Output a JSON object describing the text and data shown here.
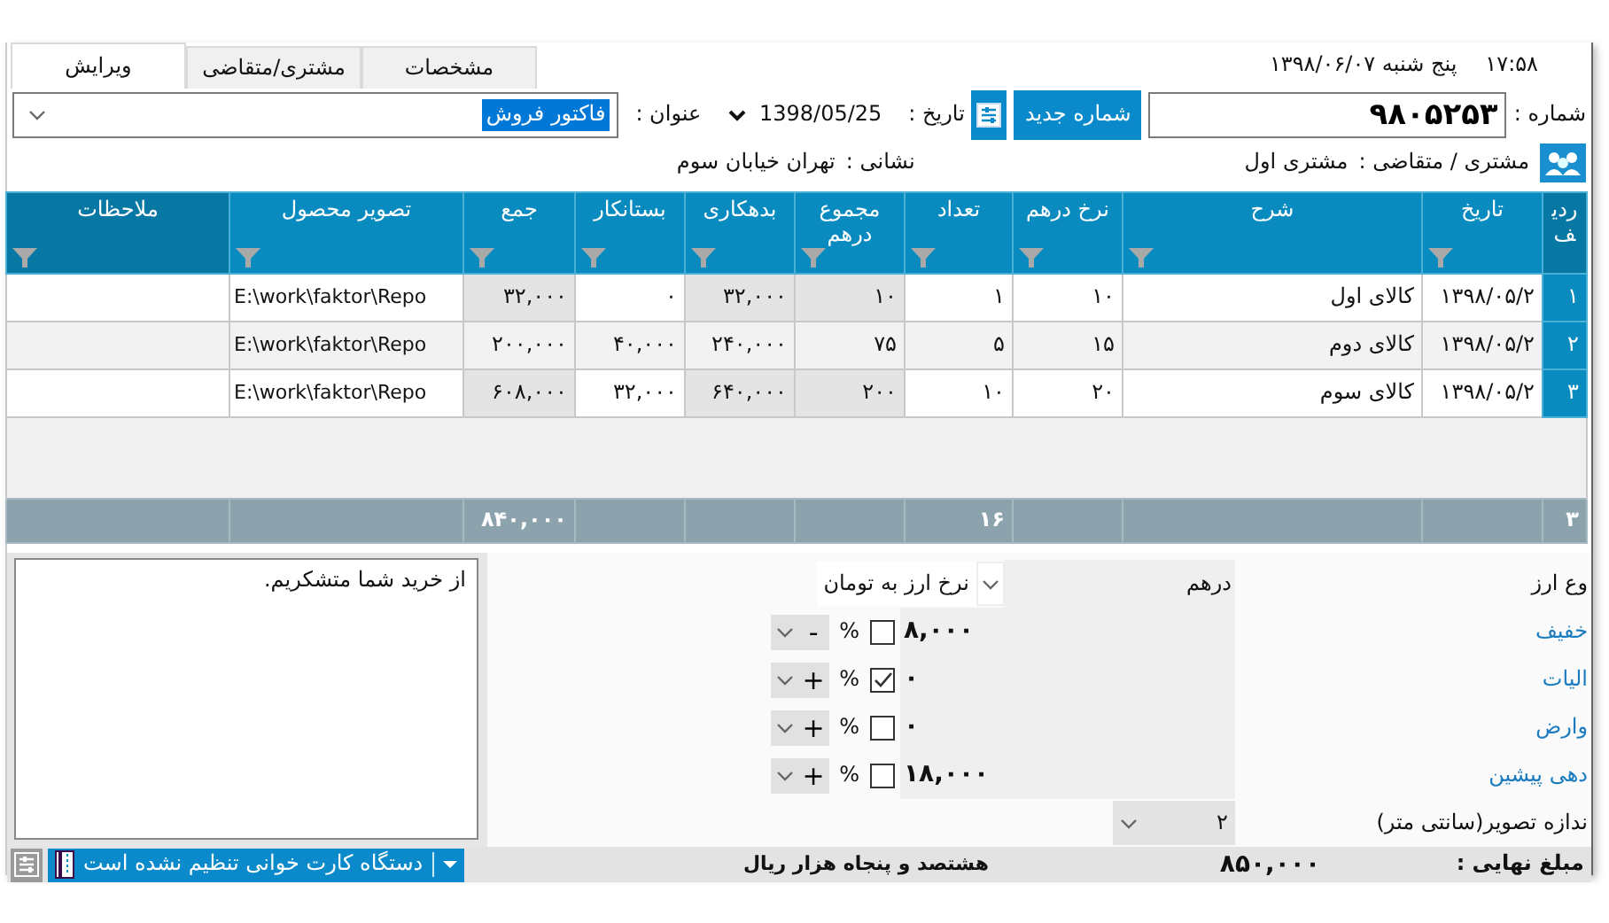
{
  "clock": {
    "time": "۱۷:۵۸",
    "date": "پنج شنبه  ۱۳۹۸/۰۶/۰۷"
  },
  "tabs": [
    {
      "label": "مشخصات",
      "selected": false
    },
    {
      "label": "مشتری/متقاضی",
      "selected": false
    },
    {
      "label": "ویرایش",
      "selected": true
    }
  ],
  "number": {
    "label": "شماره :",
    "value": "۹۸۰۵۲۵۳",
    "new_button": "شماره جدید"
  },
  "date": {
    "label": "تاریخ :",
    "value": "1398/05/25"
  },
  "title": {
    "label": "عنوان :",
    "value": "فاکتور فروش",
    "highlighted": true
  },
  "customer": {
    "label": "مشتری / متقاضی :",
    "value": "مشتری اول"
  },
  "address": {
    "label": "نشانی :",
    "value": "تهران خیابان سوم"
  },
  "table": {
    "columns": [
      {
        "label": "ردیف",
        "filter": false,
        "total": "۳"
      },
      {
        "label": "تاریخ",
        "filter": true,
        "computed": false
      },
      {
        "label": "شرح",
        "filter": true,
        "computed": false
      },
      {
        "label": "نرخ درهم",
        "filter": true,
        "computed": false
      },
      {
        "label": "تعداد",
        "filter": true,
        "computed": false,
        "total": "۱۶"
      },
      {
        "label": "مجموع درهم",
        "filter": true,
        "computed": true
      },
      {
        "label": "بدهکاری",
        "filter": true,
        "computed": true
      },
      {
        "label": "بستانکار",
        "filter": true,
        "computed": false
      },
      {
        "label": "جمع",
        "filter": true,
        "computed": true,
        "total": "۸۴۰,۰۰۰"
      },
      {
        "label": "تصویر محصول",
        "filter": true,
        "computed": false
      },
      {
        "label": "ملاحظات",
        "filter": true,
        "computed": false
      }
    ],
    "rows": [
      [
        "۱",
        "۱۳۹۸/۰۵/۲",
        "کالای اول",
        "۱۰",
        "۱",
        "۱۰",
        "۳۲,۰۰۰",
        "۰",
        "۳۲,۰۰۰",
        "E:\\work\\faktor\\Repo"
      ],
      [
        "۲",
        "۱۳۹۸/۰۵/۲",
        "کالای دوم",
        "۱۵",
        "۵",
        "۷۵",
        "۲۴۰,۰۰۰",
        "۴۰,۰۰۰",
        "۲۰۰,۰۰۰",
        "E:\\work\\faktor\\Repo"
      ],
      [
        "۳",
        "۱۳۹۸/۰۵/۲",
        "کالای سوم",
        "۲۰",
        "۱۰",
        "۲۰۰",
        "۶۴۰,۰۰۰",
        "۳۲,۰۰۰",
        "۶۰۸,۰۰۰",
        "E:\\work\\faktor\\Repo"
      ]
    ]
  },
  "notes": "از خرید شما متشکریم.",
  "currency": {
    "label": "وع ارز",
    "value": "درهم",
    "rate_label": "نرخ ارز به تومان"
  },
  "adjustments": [
    {
      "label": "خفیف",
      "value": "۸,۰۰۰",
      "checked": false,
      "percent": "%",
      "sign": "-"
    },
    {
      "label": "الیات",
      "value": "۰",
      "checked": true,
      "percent": "%",
      "sign": "+"
    },
    {
      "label": "وارض",
      "value": "۰",
      "checked": false,
      "percent": "%",
      "sign": "+"
    },
    {
      "label": "دهی پیشین",
      "value": "۱۸,۰۰۰",
      "checked": false,
      "percent": "%",
      "sign": "+"
    }
  ],
  "image_size": {
    "label": "ندازه تصویر(سانتی متر)",
    "value": "۲"
  },
  "total": {
    "label": "مبلغ نهایی :",
    "value": "۸۵۰,۰۰۰",
    "words": "هشتصد و پنجاه هزار ریال"
  },
  "status": {
    "text": "دستگاه کارت خوانی تنظیم نشده است"
  }
}
